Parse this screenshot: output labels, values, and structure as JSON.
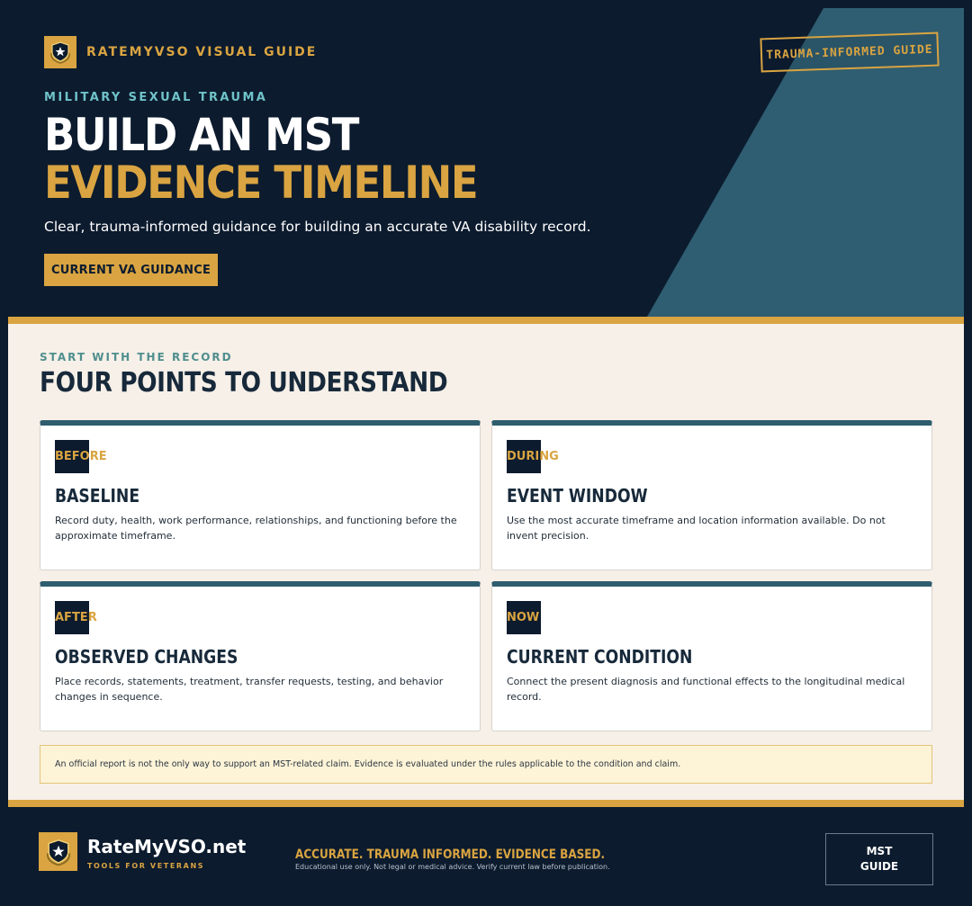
{
  "hero": {
    "brand_label": "RATEMYVSO VISUAL GUIDE",
    "stamp_label": "TRAUMA-INFORMED GUIDE",
    "eyebrow": "MILITARY SEXUAL TRAUMA",
    "headline_line1": "BUILD AN MST",
    "headline_line2": "EVIDENCE TIMELINE",
    "subtitle": "Clear, trauma-informed guidance for building an accurate VA disability record.",
    "cta_label": "CURRENT VA GUIDANCE"
  },
  "section": {
    "eyebrow": "START WITH THE RECORD",
    "title": "FOUR POINTS TO UNDERSTAND",
    "cards": [
      {
        "badge": "BEFORE",
        "title": "BASELINE",
        "body": "Record duty, health, work performance, relationships, and functioning before the approximate timeframe."
      },
      {
        "badge": "DURING",
        "title": "EVENT WINDOW",
        "body": "Use the most accurate timeframe and location information available. Do not invent precision."
      },
      {
        "badge": "AFTER",
        "title": "OBSERVED CHANGES",
        "body": "Place records, statements, treatment, transfer requests, testing, and behavior changes in sequence."
      },
      {
        "badge": "NOW",
        "title": "CURRENT CONDITION",
        "body": "Connect the present diagnosis and functional effects to the longitudinal medical record."
      }
    ],
    "notice": "An official report is not the only way to support an MST-related claim. Evidence is evaluated under the rules applicable to the condition and claim."
  },
  "footer": {
    "brand": "RateMyVSO.net",
    "tagline": "TOOLS FOR VETERANS",
    "motto": "ACCURATE. TRAUMA INFORMED. EVIDENCE BASED.",
    "disclaimer": "Educational use only. Not legal or medical advice. Verify current law before publication.",
    "box_line1": "MST",
    "box_line2": "GUIDE"
  },
  "icons": {
    "brand_logo": "shield-star-icon"
  },
  "colors": {
    "navy": "#0c1b2e",
    "gold": "#d9a441",
    "teal": "#2e5d6e",
    "cream": "#f6f0e8"
  }
}
